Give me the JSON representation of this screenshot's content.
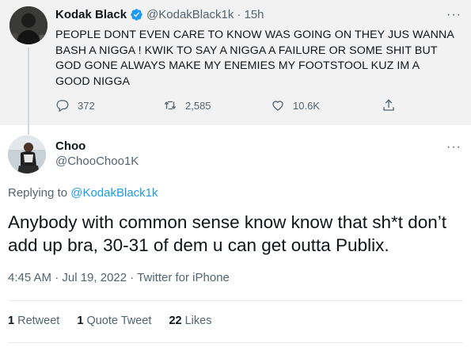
{
  "parent": {
    "name": "Kodak Black",
    "handle": "@KodakBlack1k",
    "time": "· 15h",
    "text": "PEOPLE DONT EVEN CARE TO KNOW WAS GOING ON THEY JUS WANNA BASH A NIGGA ! KWIK TO SAY A NIGGA A FAILURE OR SOME SHIT BUT GOD GONE ALWAYS MAKE MY ENEMIES MY FOOTSTOOL KUZ IM A GOOD NIGGA",
    "replies": "372",
    "retweets": "2,585",
    "likes": "10.6K",
    "more": "···",
    "icons": [
      "verified-badge-icon",
      "reply-icon",
      "retweet-icon",
      "like-icon",
      "share-icon",
      "more-icon"
    ]
  },
  "reply": {
    "name": "Choo",
    "handle": "@ChooChoo1K",
    "replying_prefix": "Replying to ",
    "replying_to": "@KodakBlack1k",
    "text": "Anybody with common sense know know that sh*t don’t add up bra, 30-31 of dem u can get outta Publix.",
    "timestamp": "4:45 AM · Jul 19, 2022 · Twitter for iPhone",
    "retweet_count": "1",
    "retweet_label": " Retweet",
    "quote_count": "1",
    "quote_label": " Quote Tweet",
    "like_count": "22",
    "like_label": " Likes",
    "more": "···"
  },
  "colors": {
    "accent": "#1d9bf0",
    "secondary_text": "#536471",
    "parent_bg": "#f2f2f2"
  }
}
